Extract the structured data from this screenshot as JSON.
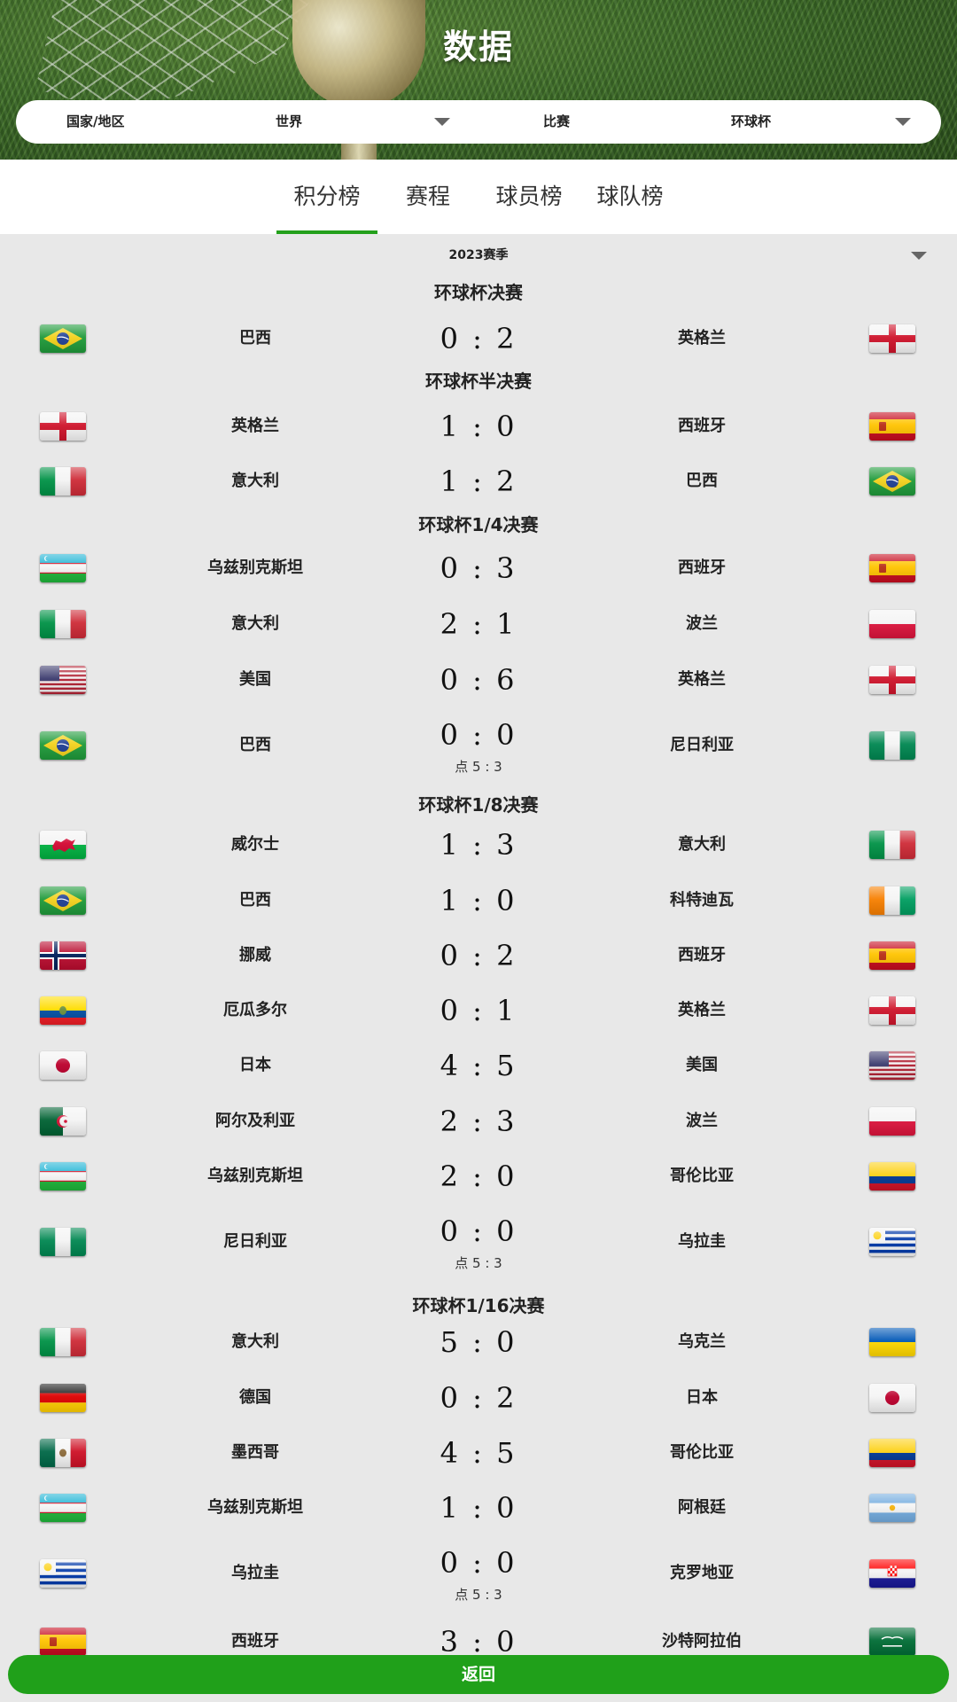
{
  "header": {
    "title": "数据",
    "filters": {
      "region_label": "国家/地区",
      "region_value": "世界",
      "competition_label": "比赛",
      "competition_value": "环球杯"
    }
  },
  "tabs": [
    {
      "label": "积分榜",
      "active": true
    },
    {
      "label": "赛程",
      "active": false
    },
    {
      "label": "球员榜",
      "active": false
    },
    {
      "label": "球队榜",
      "active": false
    }
  ],
  "season": "2023赛季",
  "rounds": [
    {
      "title": "环球杯决赛",
      "matches": [
        {
          "home": "巴西",
          "home_flag": "brazil",
          "score": "0 : 2",
          "penalty": "",
          "away": "英格兰",
          "away_flag": "england"
        }
      ]
    },
    {
      "title": "环球杯半决赛",
      "matches": [
        {
          "home": "英格兰",
          "home_flag": "england",
          "score": "1 : 0",
          "penalty": "",
          "away": "西班牙",
          "away_flag": "spain"
        },
        {
          "home": "意大利",
          "home_flag": "italy",
          "score": "1 : 2",
          "penalty": "",
          "away": "巴西",
          "away_flag": "brazil"
        }
      ]
    },
    {
      "title": "环球杯1/4决赛",
      "matches": [
        {
          "home": "乌兹别克斯坦",
          "home_flag": "uzbekistan",
          "score": "0 : 3",
          "penalty": "",
          "away": "西班牙",
          "away_flag": "spain"
        },
        {
          "home": "意大利",
          "home_flag": "italy",
          "score": "2 : 1",
          "penalty": "",
          "away": "波兰",
          "away_flag": "poland"
        },
        {
          "home": "美国",
          "home_flag": "usa",
          "score": "0 : 6",
          "penalty": "",
          "away": "英格兰",
          "away_flag": "england"
        },
        {
          "home": "巴西",
          "home_flag": "brazil",
          "score": "0 : 0",
          "penalty": "点 5 : 3",
          "away": "尼日利亚",
          "away_flag": "nigeria"
        }
      ]
    },
    {
      "title": "环球杯1/8决赛",
      "matches": [
        {
          "home": "威尔士",
          "home_flag": "wales",
          "score": "1 : 3",
          "penalty": "",
          "away": "意大利",
          "away_flag": "italy"
        },
        {
          "home": "巴西",
          "home_flag": "brazil",
          "score": "1 : 0",
          "penalty": "",
          "away": "科特迪瓦",
          "away_flag": "ivory-coast"
        },
        {
          "home": "挪威",
          "home_flag": "norway",
          "score": "0 : 2",
          "penalty": "",
          "away": "西班牙",
          "away_flag": "spain"
        },
        {
          "home": "厄瓜多尔",
          "home_flag": "ecuador",
          "score": "0 : 1",
          "penalty": "",
          "away": "英格兰",
          "away_flag": "england"
        },
        {
          "home": "日本",
          "home_flag": "japan",
          "score": "4 : 5",
          "penalty": "",
          "away": "美国",
          "away_flag": "usa"
        },
        {
          "home": "阿尔及利亚",
          "home_flag": "algeria",
          "score": "2 : 3",
          "penalty": "",
          "away": "波兰",
          "away_flag": "poland"
        },
        {
          "home": "乌兹别克斯坦",
          "home_flag": "uzbekistan",
          "score": "2 : 0",
          "penalty": "",
          "away": "哥伦比亚",
          "away_flag": "colombia"
        },
        {
          "home": "尼日利亚",
          "home_flag": "nigeria",
          "score": "0 : 0",
          "penalty": "点 5 : 3",
          "away": "乌拉圭",
          "away_flag": "uruguay"
        }
      ]
    },
    {
      "title": "环球杯1/16决赛",
      "matches": [
        {
          "home": "意大利",
          "home_flag": "italy",
          "score": "5 : 0",
          "penalty": "",
          "away": "乌克兰",
          "away_flag": "ukraine"
        },
        {
          "home": "德国",
          "home_flag": "germany",
          "score": "0 : 2",
          "penalty": "",
          "away": "日本",
          "away_flag": "japan"
        },
        {
          "home": "墨西哥",
          "home_flag": "mexico",
          "score": "4 : 5",
          "penalty": "",
          "away": "哥伦比亚",
          "away_flag": "colombia"
        },
        {
          "home": "乌兹别克斯坦",
          "home_flag": "uzbekistan",
          "score": "1 : 0",
          "penalty": "",
          "away": "阿根廷",
          "away_flag": "argentina"
        },
        {
          "home": "乌拉圭",
          "home_flag": "uruguay",
          "score": "0 : 0",
          "penalty": "点 5 : 3",
          "away": "克罗地亚",
          "away_flag": "croatia"
        },
        {
          "home": "西班牙",
          "home_flag": "spain",
          "score": "3 : 0",
          "penalty": "",
          "away": "沙特阿拉伯",
          "away_flag": "saudi-arabia"
        }
      ]
    }
  ],
  "back_button": "返回"
}
